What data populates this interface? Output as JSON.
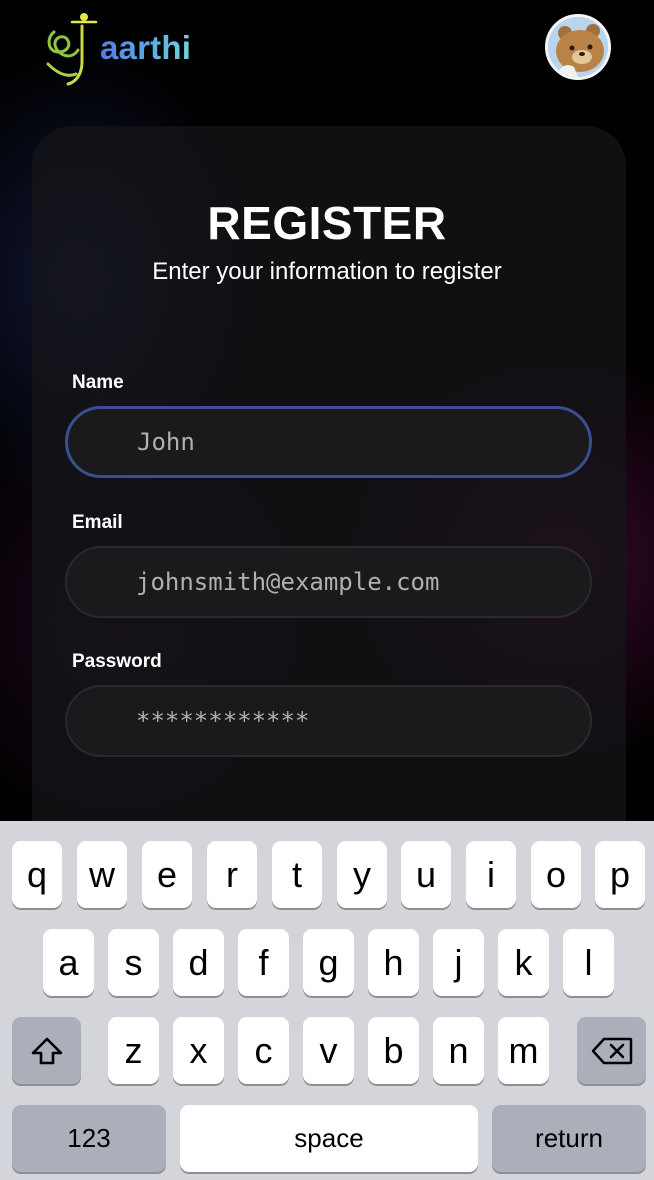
{
  "header": {
    "logo_text": "aarthi",
    "logo_icon": "saarthi-logo-icon",
    "avatar_icon": "bear-avatar"
  },
  "form": {
    "title": "REGISTER",
    "subtitle": "Enter your information to register",
    "name_label": "Name",
    "name_placeholder": "John",
    "email_label": "Email",
    "email_placeholder": "johnsmith@example.com",
    "password_label": "Password",
    "password_placeholder": "************"
  },
  "keyboard": {
    "row1": [
      "q",
      "w",
      "e",
      "r",
      "t",
      "y",
      "u",
      "i",
      "o",
      "p"
    ],
    "row2": [
      "a",
      "s",
      "d",
      "f",
      "g",
      "h",
      "j",
      "k",
      "l"
    ],
    "row3": [
      "z",
      "x",
      "c",
      "v",
      "b",
      "n",
      "m"
    ],
    "numbers_label": "123",
    "space_label": "space",
    "return_label": "return",
    "shift_icon": "shift-icon",
    "delete_icon": "backspace-icon"
  },
  "colors": {
    "background": "#000000",
    "card": "#141418",
    "input_bg": "#1a1a1c",
    "focus_border": "#3a4f8f",
    "logo_gradient_start": "#4f7fe0",
    "logo_gradient_end": "#6fd3d6",
    "keyboard_bg": "#d4d5da"
  }
}
